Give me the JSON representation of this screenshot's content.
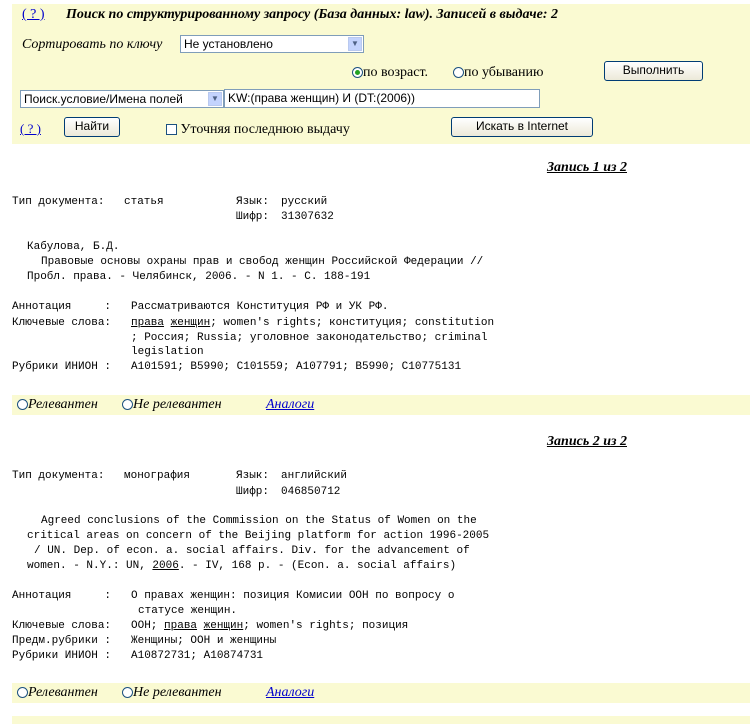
{
  "header": {
    "help": "( ? )",
    "title": "Поиск по структурированному запросу (База данных: law).   Записей в выдаче: 2"
  },
  "sort": {
    "label": "Сортировать по ключу",
    "value": "Не установлено",
    "asc_label": "по возраст.",
    "desc_label": "по убыванию",
    "asc_selected": true,
    "execute_label": "Выполнить"
  },
  "query": {
    "field_value": "Поиск.условие/Имена полей",
    "text": "KW:(права женщин) И (DT:(2006))",
    "help": "( ? )",
    "find_label": "Найти",
    "refine_label": "Уточняя последнюю выдачу",
    "internet_label": "Искать в Internet"
  },
  "records": [
    {
      "heading": "Запись 1 из 2",
      "doc_type_label": "Тип документа:",
      "doc_type": "статья",
      "lang_label": "Язык:",
      "lang": "русский",
      "code_label": "Шифр:",
      "code": "31307632",
      "author": "Кабулова, Б.Д.",
      "title_line1": "Правовые основы охраны прав и свобод женщин Российской Федерации //",
      "title_line2": "Пробл. права. - Челябинск, 2006. - N 1. - С. 188-191",
      "annotation_label": "Аннотация     :",
      "annotation": "Рассматриваются Конституция РФ и УК РФ.",
      "keywords_label": "Ключевые слова:",
      "kw_link1": "права",
      "kw_link2": "женщин",
      "kw_rest1": "; women's rights; конституция; constitution",
      "kw_rest2": "; Россия; Russia; уголовное законодательство; criminal",
      "kw_rest3": "legislation",
      "rubrics_label": "Рубрики ИНИОН :",
      "rubrics": "A101591; B5990; C101559; A107791; B5990; C10775131",
      "relevant": "Релевантен",
      "not_relevant": "Не релевантен",
      "analogs": "Аналоги"
    },
    {
      "heading": "Запись 2 из 2",
      "doc_type_label": "Тип документа:",
      "doc_type": "монография",
      "lang_label": "Язык:",
      "lang": "английский",
      "code_label": "Шифр:",
      "code": "046850712",
      "title_line1": "Agreed conclusions of the Commission on the Status of Women on the",
      "title_line2": "critical areas on concern of the Beijing platform for action 1996-2005",
      "title_line3": "/ UN. Dep. of econ. a. social affairs. Div. for the advancement of",
      "title_line4a": "women. - N.Y.: UN, ",
      "title_year": "2006",
      "title_line4b": ". - IV, 168 p. - (Econ. a. social affairs)",
      "annotation_label": "Аннотация     :",
      "annotation1": "О правах женщин: позиция Комисии ООН по вопросу о",
      "annotation2": "статусе женщин.",
      "keywords_label": "Ключевые слова:",
      "kw_pre": "ООН; ",
      "kw_link1": "права",
      "kw_link2": "женщин",
      "kw_rest1": "; women's rights; позиция",
      "subject_label": "Предм.рубрики :",
      "subject": "Женщины; ООН и женщины",
      "rubrics_label": "Рубрики ИНИОН :",
      "rubrics": "A10872731; A10874731",
      "relevant": "Релевантен",
      "not_relevant": "Не релевантен",
      "analogs": "Аналоги"
    }
  ]
}
